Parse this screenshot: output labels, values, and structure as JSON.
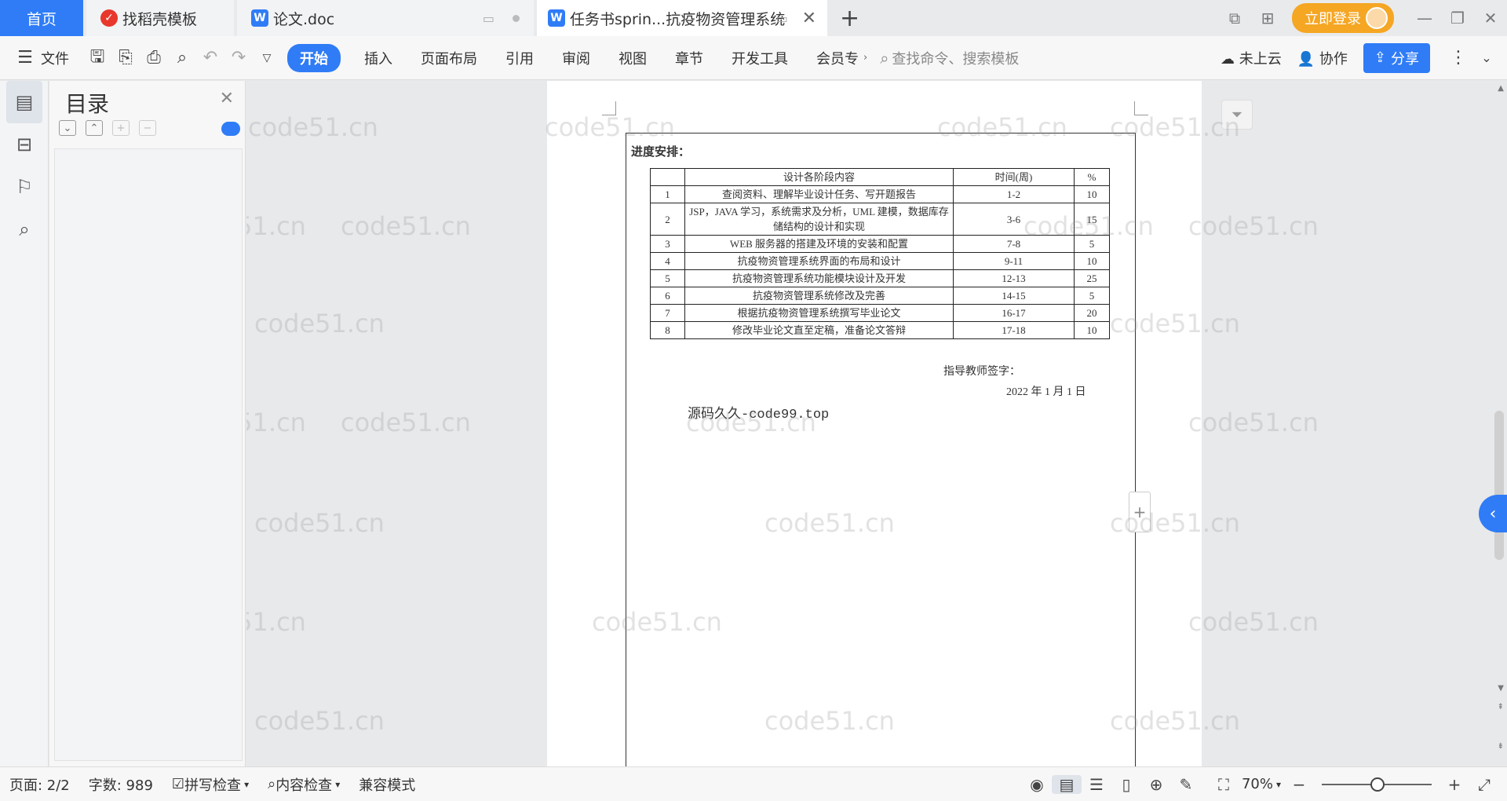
{
  "tabs": {
    "home": "首页",
    "template": "找稻壳模板",
    "doc1": "论文.doc",
    "doc2": "任务书sprin...抗疫物资管理系统"
  },
  "top_right": {
    "login": "立即登录"
  },
  "toolbar": {
    "file": "文件",
    "start": "开始",
    "insert": "插入",
    "layout": "页面布局",
    "reference": "引用",
    "review": "审阅",
    "view": "视图",
    "chapter": "章节",
    "dev": "开发工具",
    "member": "会员专",
    "search_placeholder": "查找命令、搜索模板",
    "cloud": "未上云",
    "collab": "协作",
    "share": "分享"
  },
  "toc": {
    "title": "目录"
  },
  "document": {
    "progress_title": "进度安排：",
    "table_headers": [
      "",
      "设计各阶段内容",
      "时间(周)",
      "%"
    ],
    "rows": [
      [
        "1",
        "查阅资料、理解毕业设计任务、写开题报告",
        "1-2",
        "10"
      ],
      [
        "2",
        "JSP，JAVA 学习，系统需求及分析，UML 建模，数据库存储结构的设计和实现",
        "3-6",
        "15"
      ],
      [
        "3",
        "WEB 服务器的搭建及环境的安装和配置",
        "7-8",
        "5"
      ],
      [
        "4",
        "抗疫物资管理系统界面的布局和设计",
        "9-11",
        "10"
      ],
      [
        "5",
        "抗疫物资管理系统功能模块设计及开发",
        "12-13",
        "25"
      ],
      [
        "6",
        "抗疫物资管理系统修改及完善",
        "14-15",
        "5"
      ],
      [
        "7",
        "根据抗疫物资管理系统撰写毕业论文",
        "16-17",
        "20"
      ],
      [
        "8",
        "修改毕业论文直至定稿，准备论文答辩",
        "17-18",
        "10"
      ]
    ],
    "signature": "指导教师签字：",
    "date": "2022 年 1 月 1 日",
    "source": "源码久久-code99.top"
  },
  "watermark": "code51.cn",
  "status": {
    "page": "页面: 2/2",
    "words": "字数: 989",
    "spell": "拼写检查",
    "content": "内容检查",
    "compat": "兼容模式",
    "zoom": "70%"
  },
  "colors": {
    "accent": "#2f7cf6",
    "login": "#f5a623"
  }
}
